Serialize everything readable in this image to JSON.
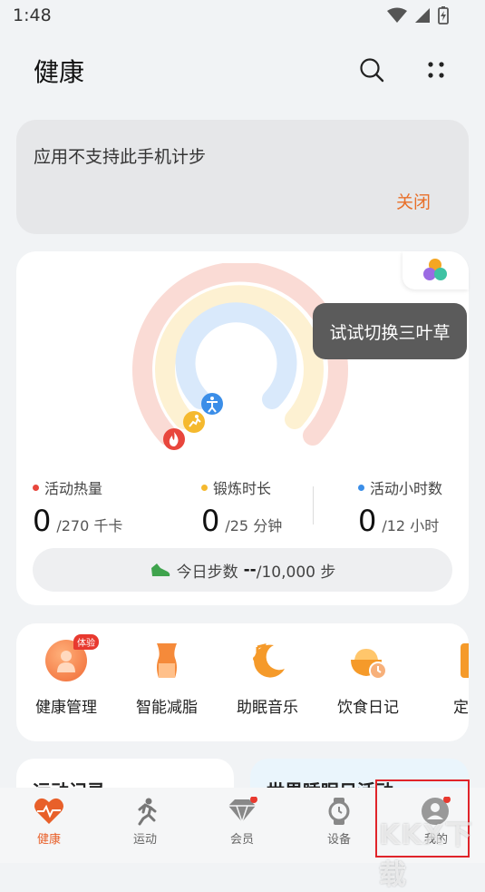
{
  "status_bar": {
    "time": "1:48"
  },
  "header": {
    "title": "健康"
  },
  "notice": {
    "text": "应用不支持此手机计步",
    "close_label": "关闭"
  },
  "activity": {
    "tooltip": "试试切换三叶草",
    "stats": [
      {
        "label": "活动热量",
        "value": "0",
        "goal": "/270 千卡",
        "color": "#e8463c"
      },
      {
        "label": "锻炼时长",
        "value": "0",
        "goal": "/25 分钟",
        "color": "#f5b92e"
      },
      {
        "label": "活动小时数",
        "value": "0",
        "goal": "/12 小时",
        "color": "#3b8ee8"
      }
    ],
    "steps": {
      "label": "今日步数",
      "value": "--",
      "goal": "/10,000 步"
    }
  },
  "services": [
    {
      "label": "健康管理",
      "badge": "体验"
    },
    {
      "label": "智能减脂"
    },
    {
      "label": "助眠音乐"
    },
    {
      "label": "饮食日记"
    },
    {
      "label": "定制"
    }
  ],
  "bottom_cards": [
    {
      "title": "运动记录"
    },
    {
      "title": "世界睡眠日活动"
    }
  ],
  "nav": {
    "items": [
      {
        "label": "健康"
      },
      {
        "label": "运动"
      },
      {
        "label": "会员"
      },
      {
        "label": "设备"
      },
      {
        "label": "我的"
      }
    ]
  },
  "watermark": "KKX下载",
  "colors": {
    "accent": "#e8602a",
    "close": "#e8702a",
    "highlight": "#e0242a"
  }
}
